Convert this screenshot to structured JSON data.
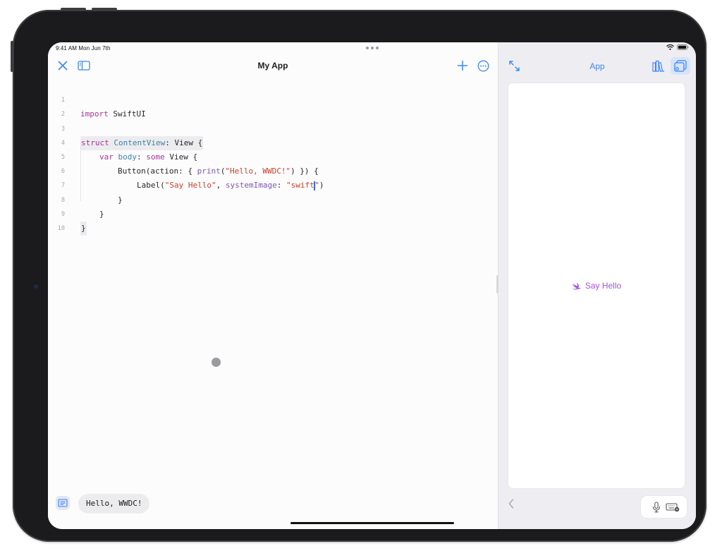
{
  "status_bar": {
    "time": "9:41 AM  Mon Jun 7th"
  },
  "editor": {
    "title": "My App",
    "lines": [
      {
        "num": "1"
      },
      {
        "num": "2"
      },
      {
        "num": "3"
      },
      {
        "num": "4"
      },
      {
        "num": "5"
      },
      {
        "num": "6"
      },
      {
        "num": "7"
      },
      {
        "num": "8"
      },
      {
        "num": "9"
      },
      {
        "num": "10"
      }
    ],
    "code": {
      "l1_kw": "import",
      "l1_mod": " SwiftUI",
      "l3_kw": "struct",
      "l3_name": " ContentView",
      "l3_rest": ": View {",
      "l4_kw": "var",
      "l4_name": " body",
      "l4_colon": ": ",
      "l4_some": "some",
      "l4_rest": " View {",
      "l5_a": "Button(action: { ",
      "l5_fn": "print",
      "l5_open": "(",
      "l5_str": "\"Hello, WWDC!\"",
      "l5_rest": ") }) {",
      "l6_a": "Label(",
      "l6_str1": "\"Say Hello\"",
      "l6_comma": ", ",
      "l6_param": "systemImage",
      "l6_colon": ": ",
      "l6_str2a": "\"swift",
      "l6_str2b": "\"",
      "l6_close": ")",
      "l7": "}",
      "l8": "}",
      "l9": "}"
    },
    "console_output": "Hello, WWDC!"
  },
  "preview": {
    "title": "App",
    "button_label": "Say Hello"
  },
  "colors": {
    "keyword": "#a8329b",
    "type": "#3e82a6",
    "function": "#7c55b3",
    "string": "#c8412a",
    "accent": "#3a86f5",
    "preview_button": "#a451e0"
  },
  "icons": [
    "close-icon",
    "sidebar-icon",
    "plus-icon",
    "more-icon",
    "expand-icon",
    "library-icon",
    "app-preview-icon",
    "swift-icon",
    "chevron-left-icon",
    "microphone-icon",
    "keyboard-icon",
    "console-icon",
    "wifi-icon",
    "battery-icon"
  ]
}
